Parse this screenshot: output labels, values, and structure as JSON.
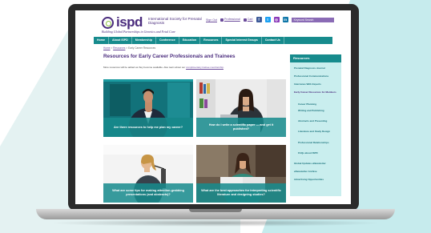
{
  "site": {
    "logo_text": "ispd",
    "org_name": "International Society for Prenatal Diagnosis",
    "tagline": "Building Global Partnerships in Genetics and Fetal Care"
  },
  "utility": {
    "sign_out": "Sign Out",
    "professional": "Professional",
    "cart": "Cart",
    "keyword_search_placeholder": "Keyword Search"
  },
  "social": [
    {
      "icon": "facebook-icon",
      "glyph": "f",
      "color": "#3b5998"
    },
    {
      "icon": "twitter-icon",
      "glyph": "t",
      "color": "#1da1f2"
    },
    {
      "icon": "instagram-icon",
      "glyph": "◎",
      "color": "#8a3ab9"
    },
    {
      "icon": "linkedin-icon",
      "glyph": "in",
      "color": "#0e76a8"
    }
  ],
  "nav": [
    "Home",
    "About ISPD",
    "Membership",
    "Conference",
    "Education",
    "Resources",
    "Special Interest Groups",
    "Contact Us"
  ],
  "breadcrumb": {
    "home": "Home",
    "section": "Resources",
    "current": "Early Career Resources"
  },
  "page": {
    "title": "Resources for Early Career Professionals and Trainees",
    "intro_text": "More resources will be added as they become available. Also learn about our",
    "intro_link": "complimentary trainee membership"
  },
  "cards": [
    {
      "caption": "Are there resources to help me plan my career?"
    },
    {
      "caption": "How do I write a scientific paper — and get it published?"
    },
    {
      "caption": "What are some tips for making attention-grabbing presentations (and abstracts)?"
    },
    {
      "caption": "What are the best approaches for interpreting scientific literature and designing studies?"
    }
  ],
  "sidebar": {
    "title": "Resources",
    "items": [
      "Prenatal Diagnosis Journal",
      "Professional Communications",
      "Interviews With Experts",
      "Early Career Resources for Members",
      "Career Planning",
      "Writing and Publishing",
      "Abstracts and Presenting",
      "Literature and Study Design",
      "Professional Relationships",
      "FAQs about ISPD",
      "Global Updates eNewsletter",
      "eNewsletter Archive",
      "Advertising Opportunities"
    ]
  },
  "colors": {
    "brand_purple": "#4a2c7d",
    "brand_teal": "#178b8d",
    "sidebar_bg": "#c9eeee"
  }
}
